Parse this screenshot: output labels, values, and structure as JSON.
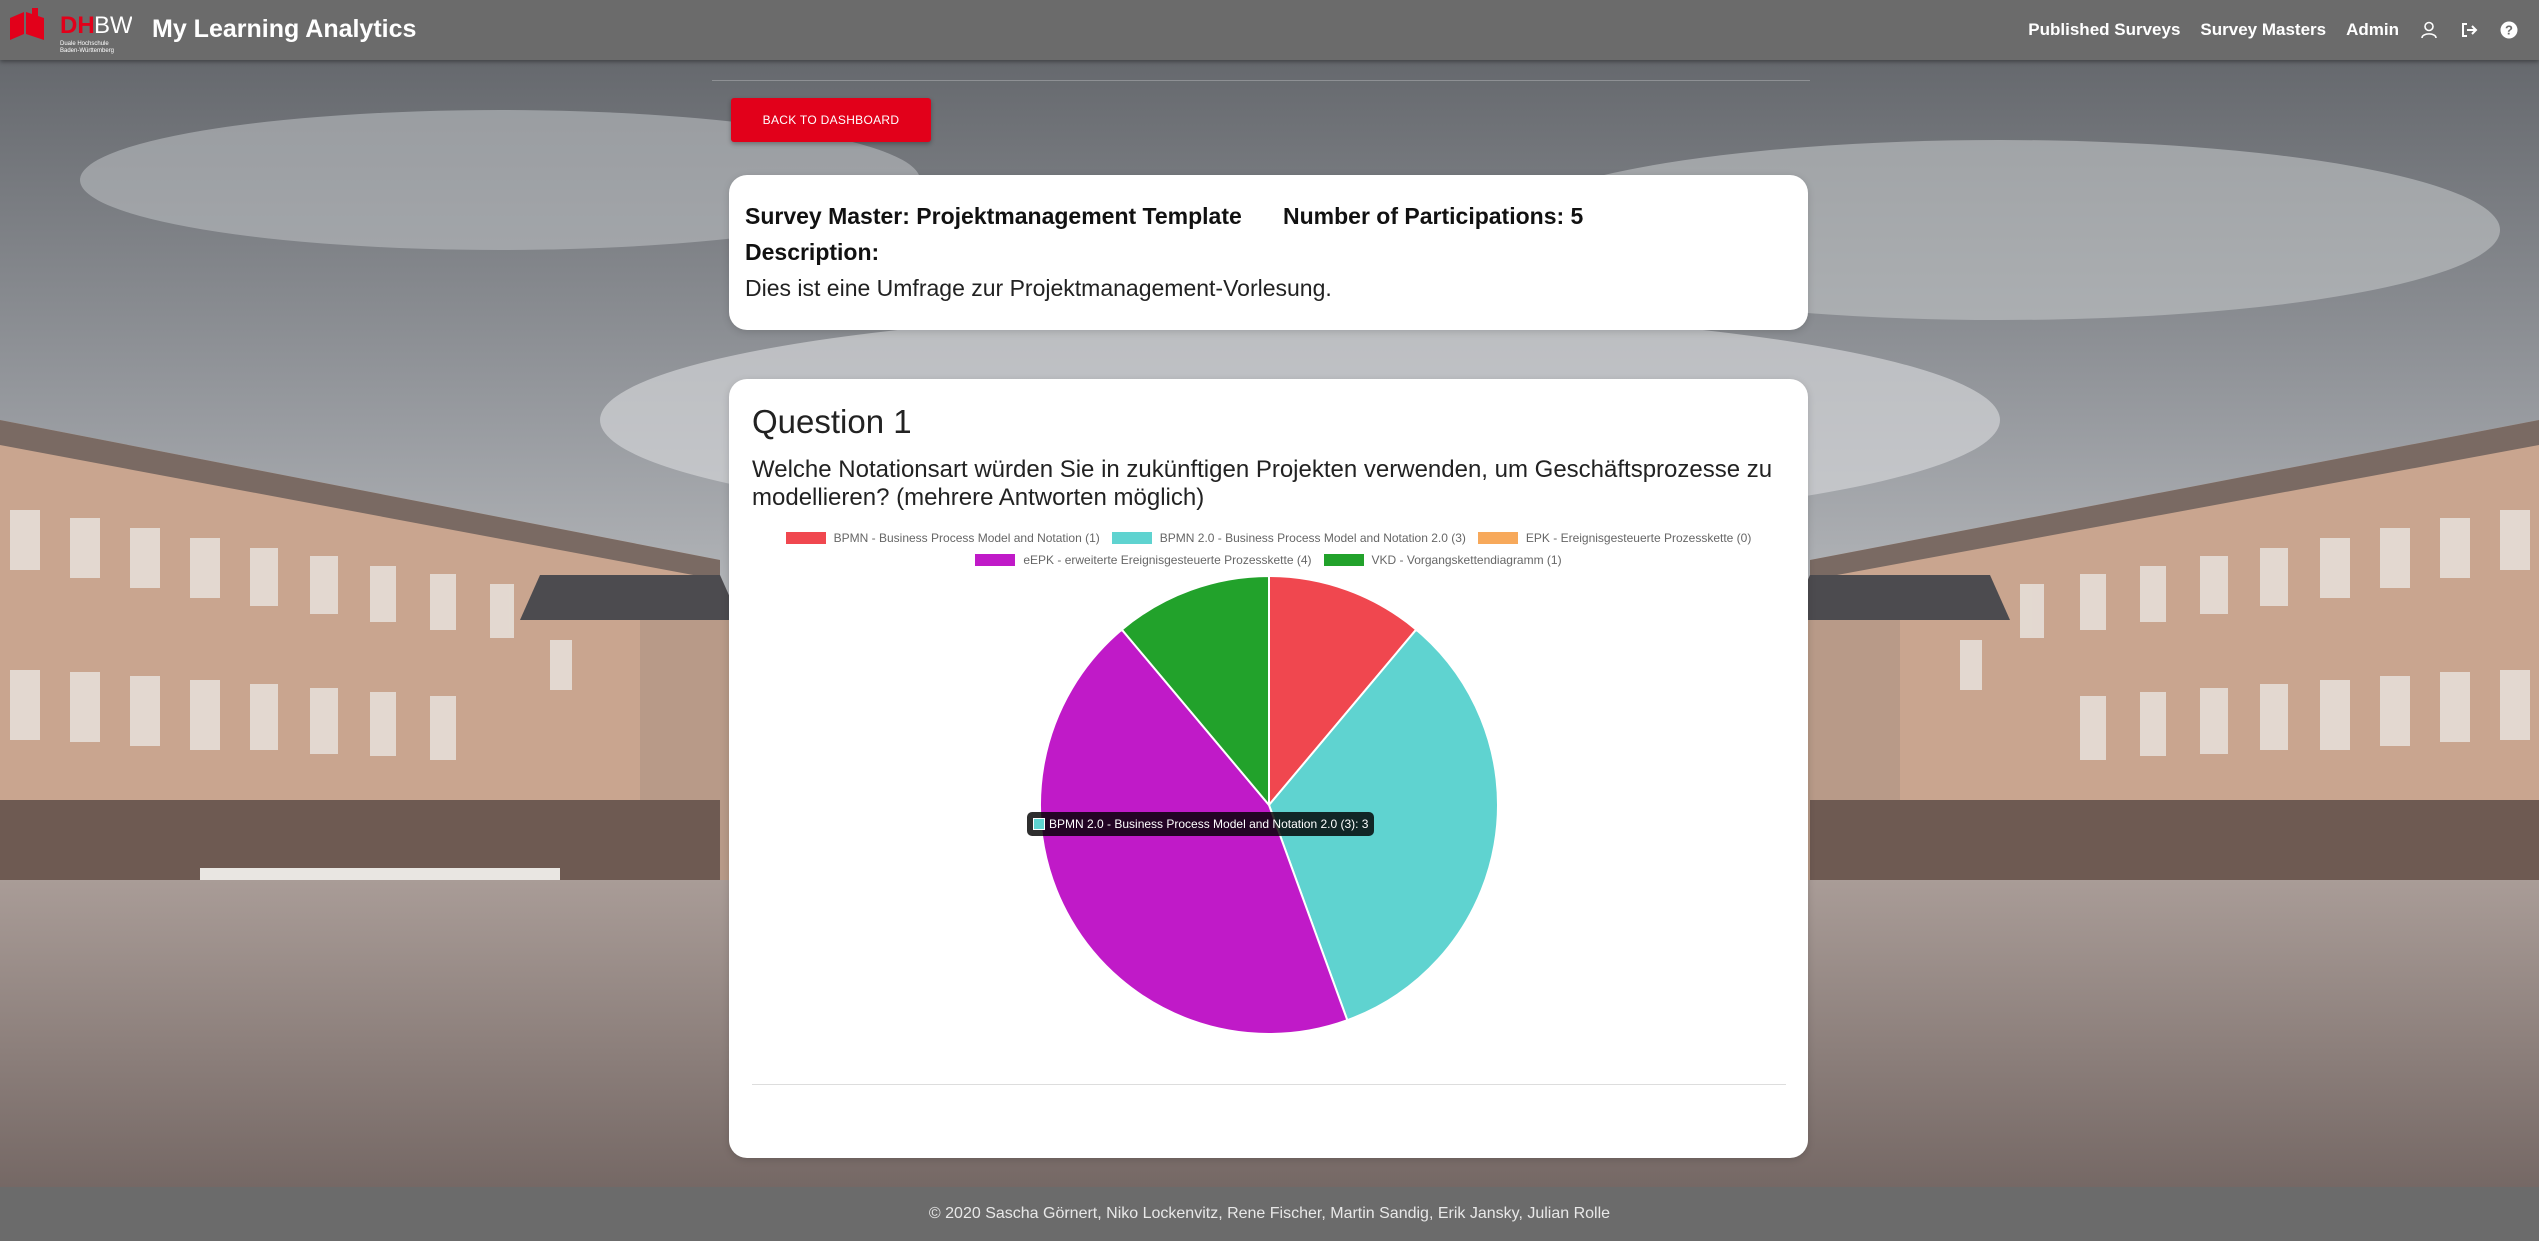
{
  "header": {
    "logo_text": "DHBW",
    "logo_subtext": "Duale Hochschule Baden-Württemberg",
    "title": "My Learning Analytics",
    "nav": {
      "published_surveys": "Published Surveys",
      "survey_masters": "Survey Masters",
      "admin": "Admin"
    },
    "icons": [
      "user-icon",
      "logout-icon",
      "help-icon"
    ]
  },
  "back_button": "BACK TO DASHBOARD",
  "survey": {
    "master_label": "Survey Master: Projektmanagement Template",
    "participations_label": "Number of Participations: 5",
    "description_label": "Description:",
    "description_text": "Dies ist eine Umfrage zur Projektmanagement-Vorlesung."
  },
  "question": {
    "title": "Question 1",
    "text": "Welche Notationsart würden Sie in zukünftigen Projekten verwenden, um Geschäftsprozesse zu modellieren? (mehrere Antworten möglich)"
  },
  "chart_data": {
    "type": "pie",
    "categories": [
      "BPMN - Business Process Model and Notation (1)",
      "BPMN 2.0 - Business Process Model and Notation 2.0 (3)",
      "EPK - Ereignisgesteuerte Prozesskette (0)",
      "eEPK - erweiterte Ereignisgesteuerte Prozesskette (4)",
      "VKD - Vorgangskettendiagramm (1)"
    ],
    "values": [
      1,
      3,
      0,
      4,
      1
    ],
    "colors": [
      "#f0474f",
      "#5fd3d0",
      "#f7a95b",
      "#c01ac8",
      "#22a22b"
    ],
    "legend_position": "top",
    "tooltip": "BPMN 2.0 - Business Process Model and Notation 2.0 (3): 3"
  },
  "footer": "© 2020 Sascha Görnert, Niko Lockenvitz, Rene Fischer, Martin Sandig, Erik Jansky, Julian Rolle"
}
